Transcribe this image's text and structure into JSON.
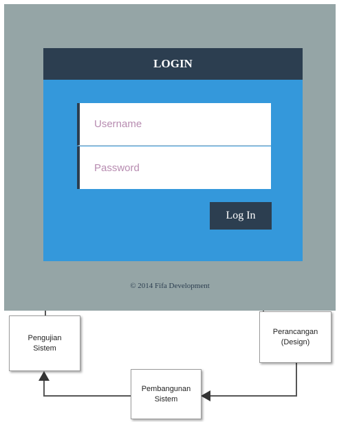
{
  "login": {
    "title": "LOGIN",
    "username_placeholder": "Username",
    "password_placeholder": "Password",
    "button_label": "Log In",
    "footer": "© 2014 Fifa Development"
  },
  "diagram": {
    "pengujian": "Pengujian\nSistem",
    "perancangan": "Perancangan\n(Design)",
    "pembangunan": "Pembangunan\nSistem"
  },
  "colors": {
    "background": "#95a5a6",
    "card": "#3498db",
    "header": "#2c3e50",
    "button": "#2c3e50"
  }
}
